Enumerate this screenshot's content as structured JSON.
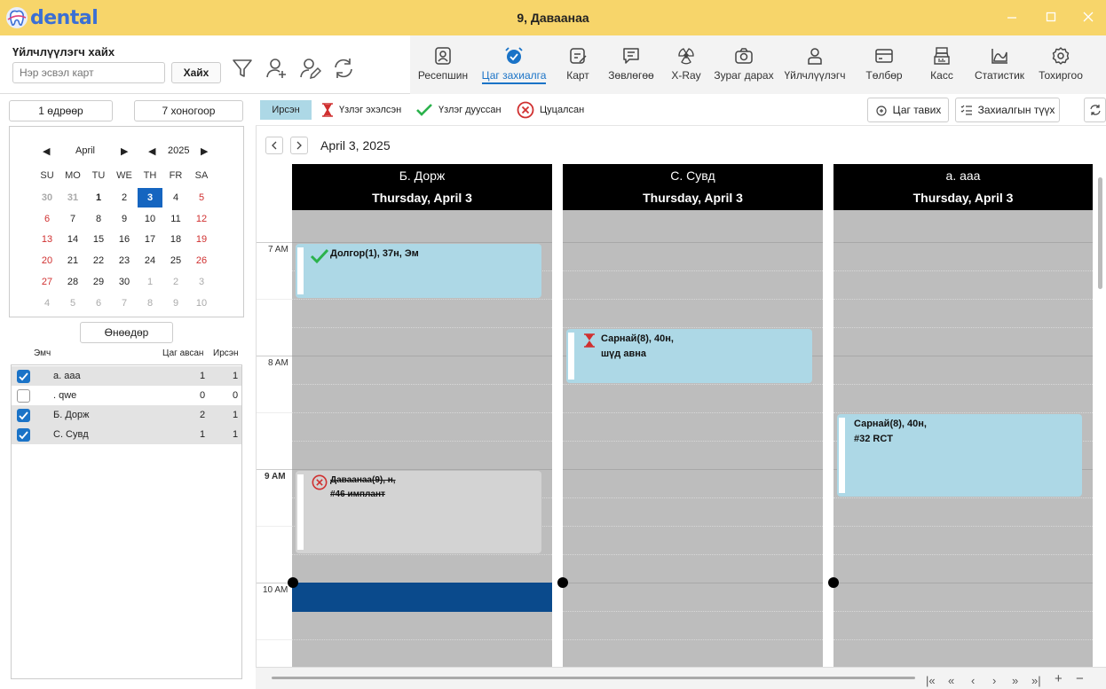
{
  "app": {
    "logo_text": "dental",
    "window_title": "9, Даваанаа"
  },
  "search": {
    "label": "Үйлчлүүлэгч хайх",
    "placeholder": "Нэр эсвэл карт",
    "button": "Хайх"
  },
  "nav": [
    {
      "label": "Ресепшин",
      "icon": "reception-icon"
    },
    {
      "label": "Цаг захиалга",
      "icon": "alarm-clock-icon"
    },
    {
      "label": "Карт",
      "icon": "card-icon"
    },
    {
      "label": "Зөвлөгөө",
      "icon": "chat-icon"
    },
    {
      "label": "X-Ray",
      "icon": "radiation-icon"
    },
    {
      "label": "Зураг дарах",
      "icon": "camera-icon"
    },
    {
      "label": "Үйлчлүүлэгч",
      "icon": "user-icon"
    },
    {
      "label": "Төлбөр",
      "icon": "wallet-icon"
    },
    {
      "label": "Касс",
      "icon": "cash-register-icon"
    },
    {
      "label": "Статистик",
      "icon": "chart-icon"
    },
    {
      "label": "Тохиргоо",
      "icon": "settings-gear-icon"
    }
  ],
  "view": {
    "one_day": "1 өдрөөр",
    "seven_day": "7 хоногоор",
    "today": "Өнөөдөр"
  },
  "calendar": {
    "month": "April",
    "year": "2025",
    "dow": [
      "SU",
      "MO",
      "TU",
      "WE",
      "TH",
      "FR",
      "SA"
    ],
    "weeks": [
      [
        "30",
        "31",
        "1",
        "2",
        "3",
        "4",
        "5"
      ],
      [
        "6",
        "7",
        "8",
        "9",
        "10",
        "11",
        "12"
      ],
      [
        "13",
        "14",
        "15",
        "16",
        "17",
        "18",
        "19"
      ],
      [
        "20",
        "21",
        "22",
        "23",
        "24",
        "25",
        "26"
      ],
      [
        "27",
        "28",
        "29",
        "30",
        "1",
        "2",
        "3"
      ],
      [
        "4",
        "5",
        "6",
        "7",
        "8",
        "9",
        "10"
      ]
    ],
    "selected": "3"
  },
  "doctors": {
    "headers": {
      "name": "Эмч",
      "booked": "Цаг авсан",
      "arrived": "Ирсэн"
    },
    "rows": [
      {
        "name": "а. ааа",
        "booked": "1",
        "arrived": "1",
        "checked": true
      },
      {
        "name": ". qwe",
        "booked": "0",
        "arrived": "0",
        "checked": false
      },
      {
        "name": "Б. Дорж",
        "booked": "2",
        "arrived": "1",
        "checked": true
      },
      {
        "name": "С. Сувд",
        "booked": "1",
        "arrived": "1",
        "checked": true
      }
    ]
  },
  "legend": {
    "arrived": "Ирсэн",
    "started": "Үзлэг эхэлсэн",
    "done": "Үзлэг дууссан",
    "cancelled": "Цуцалсан"
  },
  "actions": {
    "book": "Цаг тавих",
    "history": "Захиалгын түүх"
  },
  "scheduler": {
    "date_label": "April 3, 2025",
    "times": [
      "7 AM",
      "8 AM",
      "9 AM",
      "10 AM"
    ],
    "columns": [
      {
        "name": "Б. Дорж",
        "date": "Thursday, April 3"
      },
      {
        "name": "С. Сувд",
        "date": "Thursday, April 3"
      },
      {
        "name": "а. ааа",
        "date": "Thursday, April 3"
      }
    ],
    "appointments": [
      {
        "line1": "Долгор(1), 37н, Эм",
        "line2": "",
        "status": "done"
      },
      {
        "line1": "Сарнай(8), 40н,",
        "line2": "шүд авна",
        "status": "started"
      },
      {
        "line1": "Сарнай(8), 40н,",
        "line2": "#32 RCT",
        "status": "arrived"
      },
      {
        "line1": "Даваанаа(9), н,",
        "line2": "#46 имплант",
        "status": "cancelled"
      }
    ]
  },
  "colors": {
    "titlebar": "#f7d56a",
    "accent": "#1a73c7",
    "appointment": "#add8e6",
    "cancelled": "#d3d3d3",
    "now": "#0a4a8c"
  }
}
